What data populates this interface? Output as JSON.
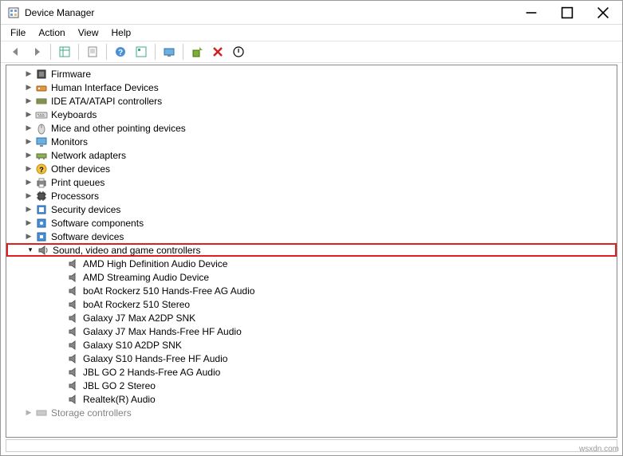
{
  "window": {
    "title": "Device Manager"
  },
  "menubar": {
    "file": "File",
    "action": "Action",
    "view": "View",
    "help": "Help"
  },
  "tree": {
    "firmware": "Firmware",
    "hid": "Human Interface Devices",
    "ide": "IDE ATA/ATAPI controllers",
    "keyboards": "Keyboards",
    "mice": "Mice and other pointing devices",
    "monitors": "Monitors",
    "network": "Network adapters",
    "other": "Other devices",
    "printq": "Print queues",
    "processors": "Processors",
    "security": "Security devices",
    "swcomp": "Software components",
    "swdev": "Software devices",
    "sound": "Sound, video and game controllers",
    "sound_children": {
      "c0": "AMD High Definition Audio Device",
      "c1": "AMD Streaming Audio Device",
      "c2": "boAt Rockerz 510 Hands-Free AG Audio",
      "c3": "boAt Rockerz 510 Stereo",
      "c4": "Galaxy J7 Max A2DP SNK",
      "c5": "Galaxy J7 Max Hands-Free HF Audio",
      "c6": "Galaxy S10 A2DP SNK",
      "c7": "Galaxy S10 Hands-Free HF Audio",
      "c8": "JBL GO 2 Hands-Free AG Audio",
      "c9": "JBL GO 2 Stereo",
      "c10": "Realtek(R) Audio"
    },
    "storage": "Storage controllers"
  },
  "watermark": "wsxdn.com"
}
